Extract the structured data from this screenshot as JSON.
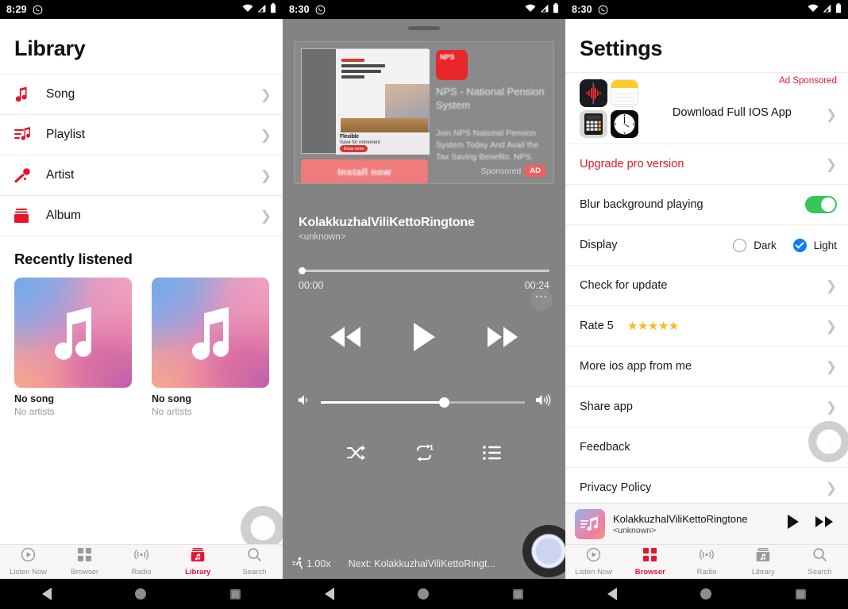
{
  "statusbars": [
    {
      "time": "8:29",
      "icons": [
        "whatsapp-icon",
        "wifi-icon",
        "signal-icon",
        "battery-icon"
      ]
    },
    {
      "time": "8:30",
      "icons": [
        "whatsapp-icon",
        "wifi-icon",
        "signal-icon",
        "battery-icon"
      ]
    },
    {
      "time": "8:30",
      "icons": [
        "whatsapp-icon",
        "wifi-icon",
        "signal-icon",
        "battery-icon"
      ]
    }
  ],
  "library": {
    "title": "Library",
    "items": [
      {
        "label": "Song",
        "icon": "music-note-icon"
      },
      {
        "label": "Playlist",
        "icon": "playlist-icon"
      },
      {
        "label": "Artist",
        "icon": "microphone-icon"
      },
      {
        "label": "Album",
        "icon": "album-icon"
      }
    ],
    "section_title": "Recently listened",
    "cards": [
      {
        "title": "No song",
        "subtitle": "No artists"
      },
      {
        "title": "No song",
        "subtitle": "No artists"
      }
    ]
  },
  "tabbar": {
    "items": [
      {
        "label": "Listen Now",
        "icon": "play-circle-icon"
      },
      {
        "label": "Browser",
        "icon": "grid-icon"
      },
      {
        "label": "Radio",
        "icon": "radio-waves-icon"
      },
      {
        "label": "Library",
        "icon": "library-icon"
      },
      {
        "label": "Search",
        "icon": "search-icon"
      }
    ],
    "active_panel1": "Library",
    "active_panel3": "Browser"
  },
  "player": {
    "ad": {
      "logo_text": "NPS",
      "title": "NPS - National Pension System",
      "description": "Join NPS  National Pension System Today And Avail the Tax Saving Benefits. NPS.",
      "cta": "Install now",
      "sponsored_label": "Sponsored",
      "ad_tag": "AD",
      "inner_headline": "Flexible",
      "inner_sub": "Save for retirement",
      "inner_pill": "Know more"
    },
    "track_title": "KolakkuzhalViliKettoRingtone",
    "track_artist": "<unknown>",
    "more_icon": "more-horizontal-icon",
    "elapsed": "00:00",
    "duration": "00:24",
    "progress_percent": 0,
    "volume_percent": 61,
    "controls": [
      "rewind-icon",
      "play-icon",
      "fast-forward-icon"
    ],
    "modes": [
      "shuffle-icon",
      "repeat-one-icon",
      "queue-list-icon"
    ],
    "speed": "1.00x",
    "speed_icon": "speed-runner-icon",
    "next_label": "Next: KolakkuzhalViliKettoRingt..."
  },
  "settings": {
    "title": "Settings",
    "ad_sponsored": "Ad Sponsored",
    "ad_row_label": "Download Full IOS App",
    "ios_icons": [
      "voice-memos-icon",
      "notes-icon",
      "calculator-icon",
      "clock-icon"
    ],
    "rows": [
      {
        "label": "Upgrade pro version",
        "type": "chevron",
        "red": true
      },
      {
        "label": "Blur background playing",
        "type": "switch",
        "value": "on"
      },
      {
        "label": "Display",
        "type": "radios"
      },
      {
        "label": "Check for update",
        "type": "chevron"
      },
      {
        "label": "Rate 5",
        "type": "stars",
        "stars": "★★★★★"
      },
      {
        "label": "More ios app from me",
        "type": "chevron"
      },
      {
        "label": "Share app",
        "type": "chevron"
      },
      {
        "label": "Feedback",
        "type": "chevron"
      },
      {
        "label": "Privacy Policy",
        "type": "chevron"
      }
    ],
    "display_options": [
      {
        "label": "Dark",
        "selected": false
      },
      {
        "label": "Light",
        "selected": true
      }
    ]
  },
  "miniplayer": {
    "title": "KolakkuzhalViliKettoRingtone",
    "artist": "<unknown>",
    "buttons": [
      "play-icon",
      "fast-forward-icon"
    ]
  },
  "androidnav": {
    "back": "back-icon",
    "home": "home-icon",
    "recents": "recents-icon"
  },
  "colors": {
    "accent_red": "#e8142c",
    "switch_green": "#34c759",
    "radio_blue": "#0a7cff",
    "star_yellow": "#f5bd1f",
    "player_bg": "#838383"
  }
}
